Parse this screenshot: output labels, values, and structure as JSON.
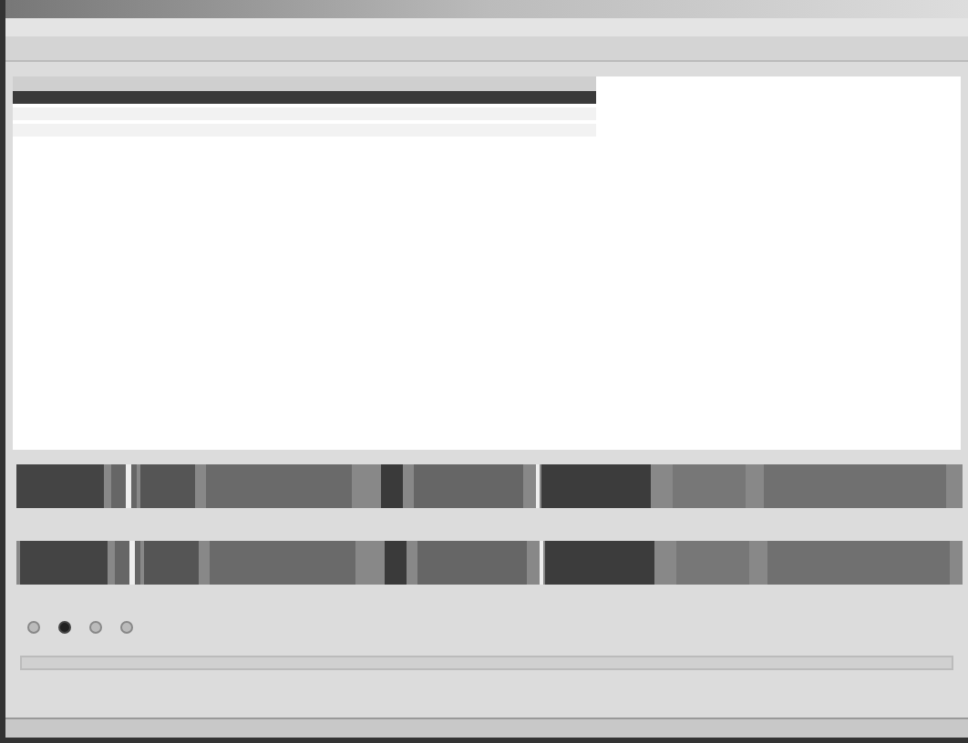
{
  "table": {
    "rows": [
      {
        "selected": true
      },
      {
        "selected": false
      },
      {
        "selected": false
      }
    ]
  },
  "radios": [
    {
      "selected": false
    },
    {
      "selected": true
    },
    {
      "selected": false
    },
    {
      "selected": false
    }
  ]
}
